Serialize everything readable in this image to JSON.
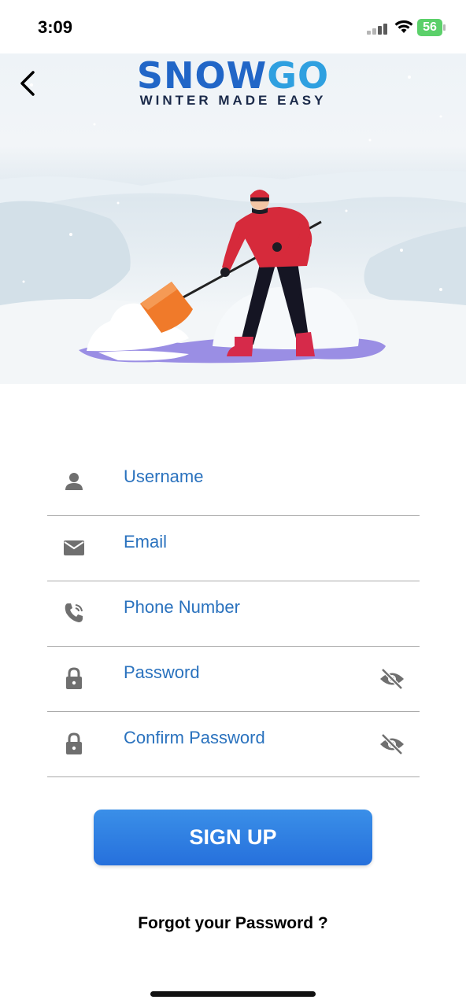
{
  "status_bar": {
    "time": "3:09",
    "battery": "56",
    "icons": [
      "signal-icon",
      "wifi-icon",
      "battery-icon"
    ]
  },
  "header": {
    "back_icon": "chevron-left-icon",
    "logo_snow": "SNOW",
    "logo_go": "GO",
    "tagline": "WINTER MADE EASY"
  },
  "form": {
    "fields": [
      {
        "placeholder": "Username",
        "icon": "person-icon"
      },
      {
        "placeholder": "Email",
        "icon": "mail-icon"
      },
      {
        "placeholder": "Phone Number",
        "icon": "phone-icon"
      },
      {
        "placeholder": "Password",
        "icon": "lock-icon",
        "toggle_icon": "eye-off-icon"
      },
      {
        "placeholder": "Confirm Password",
        "icon": "lock-icon",
        "toggle_icon": "eye-off-icon"
      }
    ],
    "signup_label": "SIGN UP",
    "forgot_label": "Forgot your Password ?"
  },
  "colors": {
    "brand_blue": "#2166c7",
    "brand_light_blue": "#2fa0e0",
    "field_text": "#2a72be",
    "button": "#2f7ee2"
  }
}
